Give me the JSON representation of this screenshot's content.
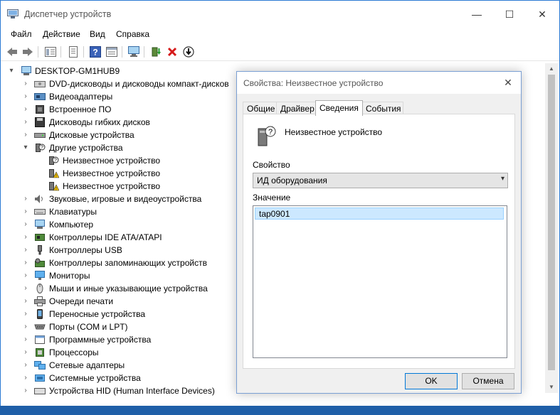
{
  "window": {
    "title": "Диспетчер устройств",
    "controls": {
      "minimize": "—",
      "maximize": "☐",
      "close": "✕"
    }
  },
  "menu": [
    "Файл",
    "Действие",
    "Вид",
    "Справка"
  ],
  "toolbar": [
    "back-icon",
    "forward-icon",
    "console-tree-icon",
    "properties-icon",
    "help-icon",
    "action-pane-icon",
    "monitor-icon",
    "update-driver-icon",
    "uninstall-icon",
    "scan-hardware-icon"
  ],
  "tree": {
    "root": "DESKTOP-GM1HUB9",
    "items": [
      {
        "label": "DVD-дисководы и дисководы компакт-дисков",
        "icon": "dvd-icon"
      },
      {
        "label": "Видеоадаптеры",
        "icon": "display-adapter-icon"
      },
      {
        "label": "Встроенное ПО",
        "icon": "firmware-icon"
      },
      {
        "label": "Дисководы гибких дисков",
        "icon": "floppy-icon"
      },
      {
        "label": "Дисковые устройства",
        "icon": "disk-icon"
      },
      {
        "label": "Другие устройства",
        "icon": "other-devices-icon",
        "expanded": true,
        "children": [
          {
            "label": "Неизвестное устройство",
            "icon": "unknown-device-icon"
          },
          {
            "label": "Неизвестное устройство",
            "icon": "warning-device-icon"
          },
          {
            "label": "Неизвестное устройство",
            "icon": "warning-device-icon"
          }
        ]
      },
      {
        "label": "Звуковые, игровые и видеоустройства",
        "icon": "sound-icon"
      },
      {
        "label": "Клавиатуры",
        "icon": "keyboard-icon"
      },
      {
        "label": "Компьютер",
        "icon": "computer-icon"
      },
      {
        "label": "Контроллеры IDE ATA/ATAPI",
        "icon": "ide-controller-icon"
      },
      {
        "label": "Контроллеры USB",
        "icon": "usb-icon"
      },
      {
        "label": "Контроллеры запоминающих устройств",
        "icon": "storage-controller-icon"
      },
      {
        "label": "Мониторы",
        "icon": "monitor-icon"
      },
      {
        "label": "Мыши и иные указывающие устройства",
        "icon": "mouse-icon"
      },
      {
        "label": "Очереди печати",
        "icon": "printer-icon"
      },
      {
        "label": "Переносные устройства",
        "icon": "portable-device-icon"
      },
      {
        "label": "Порты (COM и LPT)",
        "icon": "port-icon"
      },
      {
        "label": "Программные устройства",
        "icon": "software-device-icon"
      },
      {
        "label": "Процессоры",
        "icon": "processor-icon"
      },
      {
        "label": "Сетевые адаптеры",
        "icon": "network-adapter-icon"
      },
      {
        "label": "Системные устройства",
        "icon": "system-device-icon"
      },
      {
        "label": "Устройства HID (Human Interface Devices)",
        "icon": "hid-icon"
      }
    ]
  },
  "dialog": {
    "title": "Свойства: Неизвестное устройство",
    "tabs": [
      "Общие",
      "Драйвер",
      "Сведения",
      "События"
    ],
    "active_tab": "Сведения",
    "device_name": "Неизвестное устройство",
    "property_label": "Свойство",
    "property_value": "ИД оборудования",
    "value_label": "Значение",
    "values": [
      "tap0901"
    ],
    "ok": "OK",
    "cancel": "Отмена"
  },
  "colors": {
    "accent": "#0078d7",
    "selection": "#cce8ff",
    "warning": "#f2c100"
  }
}
